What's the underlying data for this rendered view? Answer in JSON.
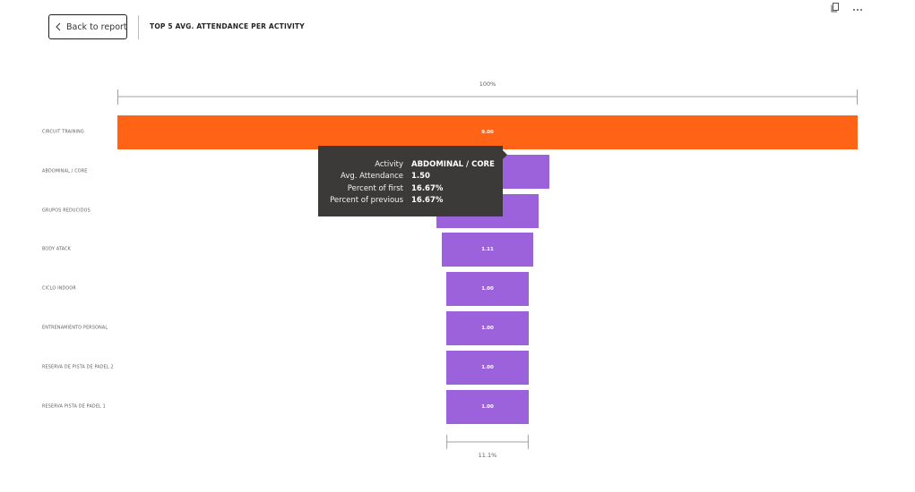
{
  "header": {
    "back_label": "Back to report",
    "title": "TOP 5 AVG. ATTENDANCE PER ACTIVITY"
  },
  "icons": {
    "copy": "copy-icon",
    "more": "more-options-icon"
  },
  "chart_data": {
    "type": "funnel",
    "categories": [
      "CIRCUIT TRAINING",
      "ABDOMINAL / CORE",
      "GRUPOS REDUCIDOS",
      "BODY ATACK",
      "CICLO INDOOR",
      "ENTRENAMIENTO PERSONAL",
      "RESERVA DE PISTA DE PADEL 2",
      "RESERVA PISTA DE PADEL 1"
    ],
    "values": [
      9.0,
      1.5,
      1.25,
      1.11,
      1.0,
      1.0,
      1.0,
      1.0
    ],
    "value_labels": [
      "9.00",
      "",
      "",
      "1.11",
      "1.00",
      "1.00",
      "1.00",
      "1.00"
    ],
    "top_percent_label": "100%",
    "bottom_percent_label": "11.1%",
    "highlight_index": 0,
    "colors": {
      "highlight": "#ff6316",
      "default": "#9b62dc"
    }
  },
  "tooltip": {
    "rows": [
      {
        "key": "Activity",
        "value": "ABDOMINAL / CORE"
      },
      {
        "key": "Avg. Attendance",
        "value": "1.50"
      },
      {
        "key": "Percent of first",
        "value": "16.67%"
      },
      {
        "key": "Percent of previous",
        "value": "16.67%"
      }
    ]
  }
}
